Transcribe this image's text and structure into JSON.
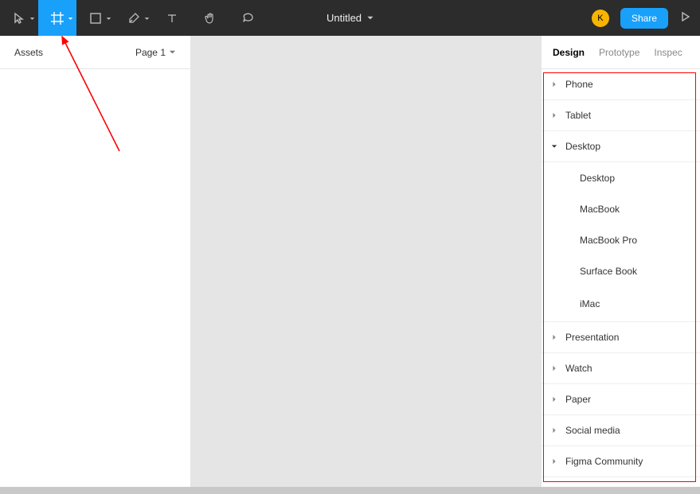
{
  "toolbar": {
    "title": "Untitled",
    "share_label": "Share",
    "avatar_initial": "K"
  },
  "left": {
    "assets_label": "Assets",
    "page_label": "Page 1"
  },
  "right": {
    "tabs": {
      "design": "Design",
      "prototype": "Prototype",
      "inspect": "Inspec"
    },
    "presets": {
      "phone": "Phone",
      "tablet": "Tablet",
      "desktop": "Desktop",
      "desktop_children": {
        "desktop": "Desktop",
        "macbook": "MacBook",
        "macbook_pro": "MacBook Pro",
        "surface_book": "Surface Book",
        "imac": "iMac"
      },
      "presentation": "Presentation",
      "watch": "Watch",
      "paper": "Paper",
      "social": "Social media",
      "community": "Figma Community"
    }
  }
}
